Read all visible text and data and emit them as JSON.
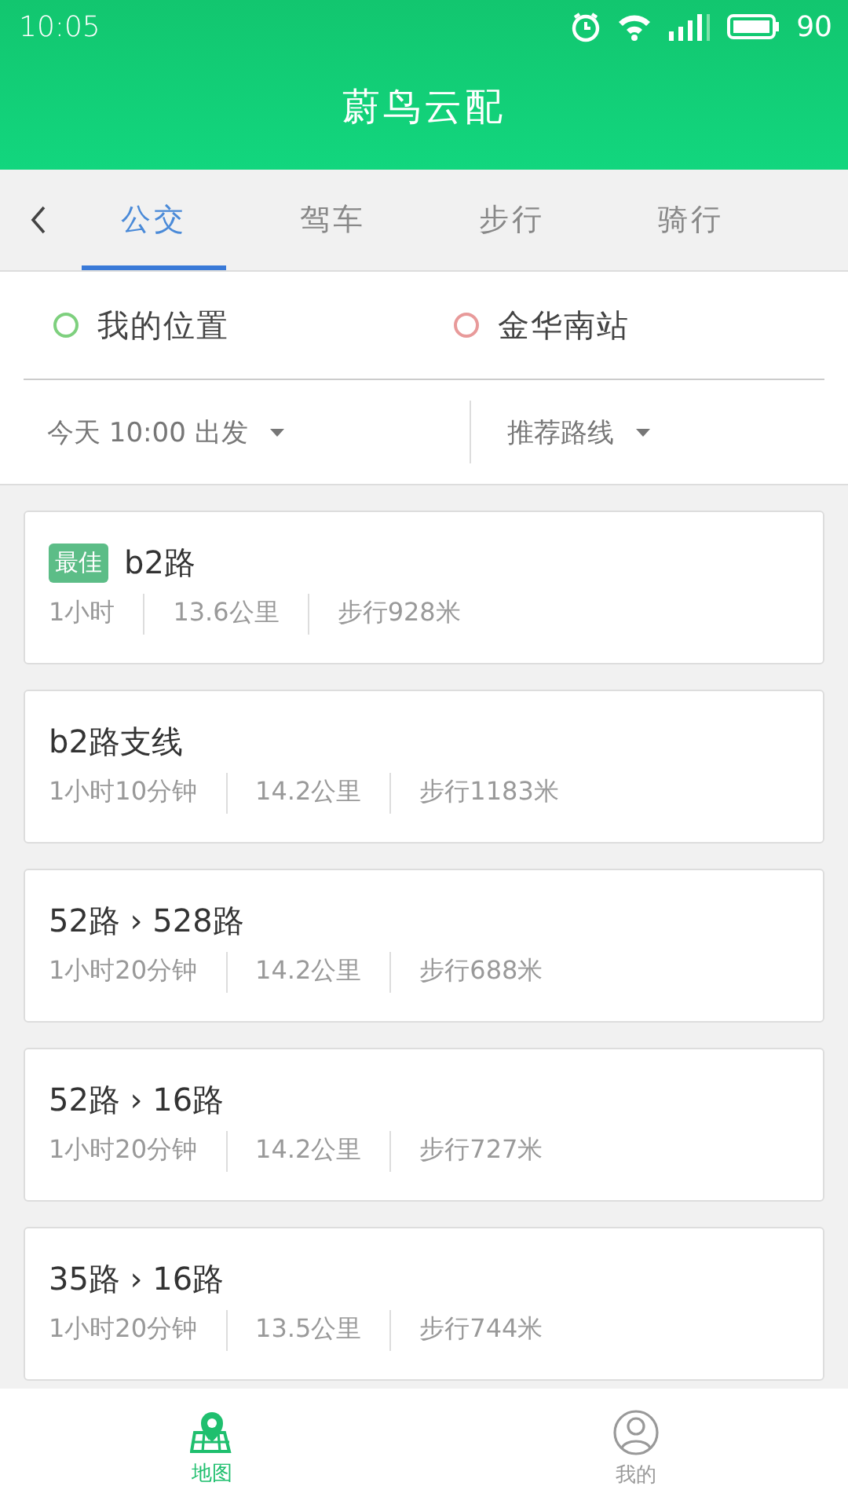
{
  "status_bar": {
    "time": "10:05",
    "battery": "90"
  },
  "header": {
    "title": "蔚鸟云配"
  },
  "tabs": [
    {
      "label": "公交",
      "selected": true
    },
    {
      "label": "驾车",
      "selected": false
    },
    {
      "label": "步行",
      "selected": false
    },
    {
      "label": "骑行",
      "selected": false
    }
  ],
  "locations": [
    {
      "label": "我的位置",
      "color": "#7ed07e"
    },
    {
      "label": "金华南站",
      "color": "#e89a9a"
    }
  ],
  "filters": [
    {
      "label": "今天  10:00  出发"
    },
    {
      "label": "推荐路线"
    }
  ],
  "routes": [
    {
      "best": true,
      "badge": "最佳",
      "title": "b2路",
      "stats": [
        "1小时",
        "13.6公里",
        "步行928米"
      ]
    },
    {
      "best": false,
      "title": "b2路支线",
      "stats": [
        "1小时10分钟",
        "14.2公里",
        "步行1183米"
      ]
    },
    {
      "best": false,
      "title": "52路 › 528路",
      "stats": [
        "1小时20分钟",
        "14.2公里",
        "步行688米"
      ]
    },
    {
      "best": false,
      "title": "52路 › 16路",
      "stats": [
        "1小时20分钟",
        "14.2公里",
        "步行727米"
      ]
    },
    {
      "best": false,
      "title": "35路 › 16路",
      "stats": [
        "1小时20分钟",
        "13.5公里",
        "步行744米"
      ]
    }
  ],
  "bottom_nav": [
    {
      "label": "地图",
      "kind": "map",
      "selected": true
    },
    {
      "label": "我的",
      "kind": "profile",
      "selected": false
    }
  ]
}
